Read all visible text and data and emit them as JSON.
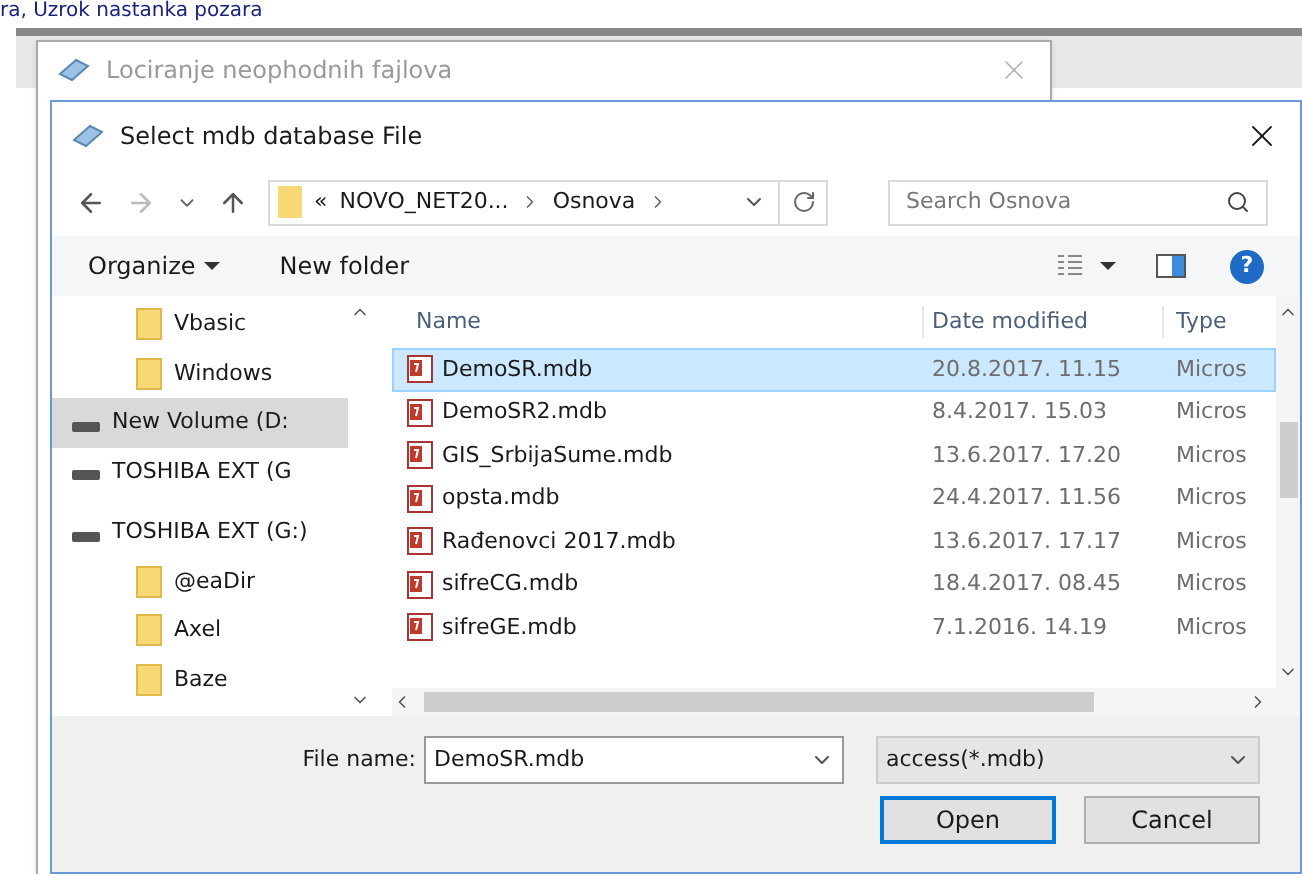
{
  "background_text": "ra, Uzrok nastanka pozara",
  "back_window": {
    "title": "Lociranje neophodnih fajlova"
  },
  "dialog": {
    "title": "Select mdb database File",
    "path": [
      "«",
      "NOVO_NET20...",
      "Osnova"
    ],
    "search": {
      "placeholder": "Search Osnova"
    },
    "toolbar": {
      "organize": "Organize",
      "new_folder": "New folder",
      "help": "?"
    },
    "nav_items": [
      {
        "label": "Vbasic",
        "kind": "folder",
        "selected": false
      },
      {
        "label": "Windows",
        "kind": "folder",
        "selected": false
      },
      {
        "label": "New Volume (D:",
        "kind": "drive",
        "selected": true
      },
      {
        "label": "TOSHIBA EXT (G",
        "kind": "drive",
        "selected": false
      },
      {
        "label": "TOSHIBA EXT (G:)",
        "kind": "drive",
        "selected": false
      },
      {
        "label": "@eaDir",
        "kind": "folder",
        "selected": false
      },
      {
        "label": "Axel",
        "kind": "folder",
        "selected": false
      },
      {
        "label": "Baze",
        "kind": "folder",
        "selected": false
      }
    ],
    "columns": [
      "Name",
      "Date modified",
      "Type"
    ],
    "rows": [
      {
        "name": "DemoSR.mdb",
        "date": "20.8.2017. 11.15",
        "type": "Micros",
        "selected": true
      },
      {
        "name": "DemoSR2.mdb",
        "date": "8.4.2017. 15.03",
        "type": "Micros",
        "selected": false
      },
      {
        "name": "GIS_SrbijaSume.mdb",
        "date": "13.6.2017. 17.20",
        "type": "Micros",
        "selected": false
      },
      {
        "name": "opsta.mdb",
        "date": "24.4.2017. 11.56",
        "type": "Micros",
        "selected": false
      },
      {
        "name": "Rađenovci 2017.mdb",
        "date": "13.6.2017. 17.17",
        "type": "Micros",
        "selected": false
      },
      {
        "name": "sifreCG.mdb",
        "date": "18.4.2017. 08.45",
        "type": "Micros",
        "selected": false
      },
      {
        "name": "sifreGE.mdb",
        "date": "7.1.2016. 14.19",
        "type": "Micros",
        "selected": false
      }
    ],
    "file_name": {
      "label": "File name:",
      "value": "DemoSR.mdb"
    },
    "file_type": "access(*.mdb)",
    "buttons": [
      {
        "label": "Open",
        "default": true
      },
      {
        "label": "Cancel",
        "default": false
      }
    ]
  }
}
